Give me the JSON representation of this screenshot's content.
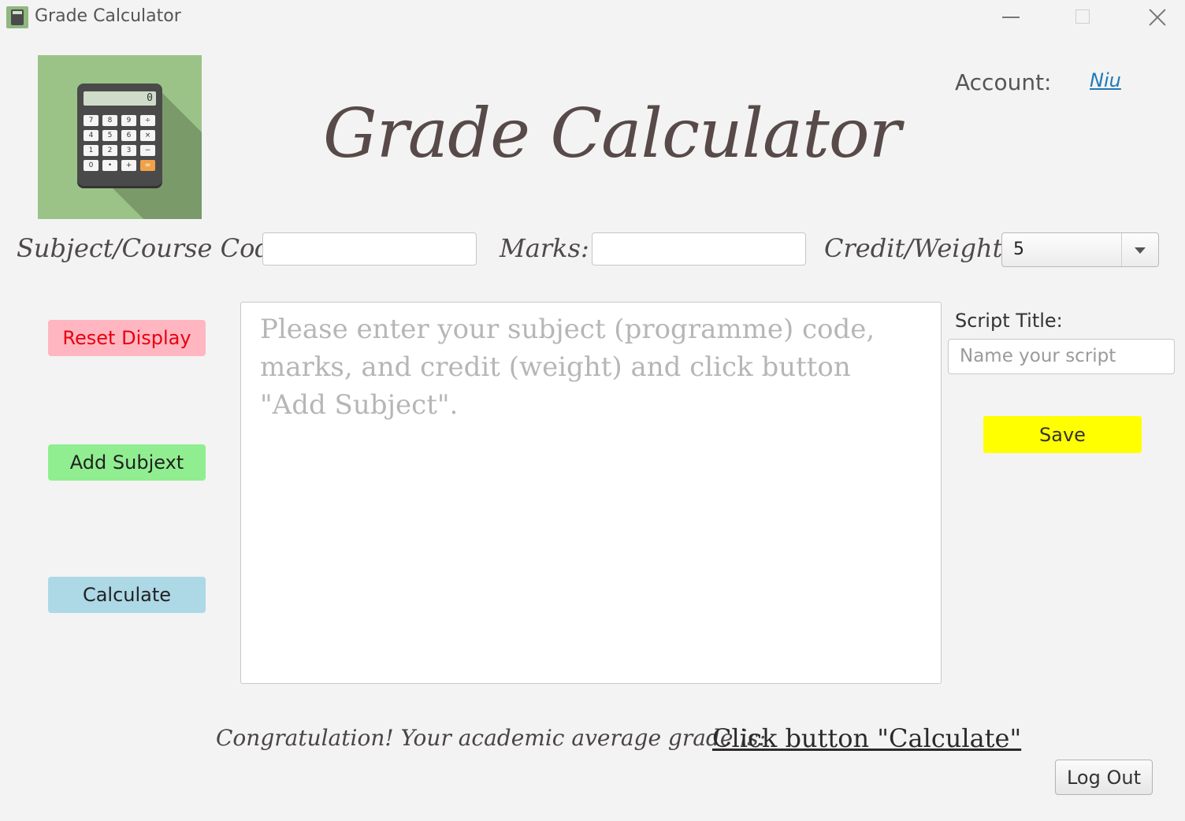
{
  "window": {
    "title": "Grade Calculator",
    "icon": "calculator-icon"
  },
  "header": {
    "title": "Grade Calculator",
    "account_label": "Account:",
    "account_name": "Niu"
  },
  "logo": {
    "icon": "calculator-icon",
    "screen_value": "0",
    "keys": [
      "7",
      "8",
      "9",
      "÷",
      "4",
      "5",
      "6",
      "×",
      "1",
      "2",
      "3",
      "−",
      "0",
      "•",
      "+",
      "="
    ],
    "colors": {
      "background": "#9bc388",
      "equals_key": "#f0a24a"
    }
  },
  "form": {
    "subject_label": "Subject/Course Code:",
    "subject_value": "",
    "marks_label": "Marks:",
    "marks_value": "",
    "credit_label": "Credit/Weight:",
    "credit_value": "5"
  },
  "actions": {
    "reset_label": "Reset Display",
    "add_label": "Add Subjext",
    "calculate_label": "Calculate",
    "save_label": "Save",
    "logout_label": "Log Out"
  },
  "display": {
    "placeholder": "Please enter your subject (programme) code, marks, and credit (weight) and click button \"Add Subject\"."
  },
  "script": {
    "label": "Script Title:",
    "placeholder": "Name your script",
    "value": ""
  },
  "footer": {
    "congrats": "Congratulation! Your academic average grade is:",
    "result": "Click button \"Calculate\""
  },
  "colors": {
    "reset_bg": "#ffb6c1",
    "reset_text": "#e8000f",
    "add_bg": "#90ee90",
    "calc_bg": "#add8e6",
    "save_bg": "#ffff00",
    "link": "#1f79b6"
  }
}
